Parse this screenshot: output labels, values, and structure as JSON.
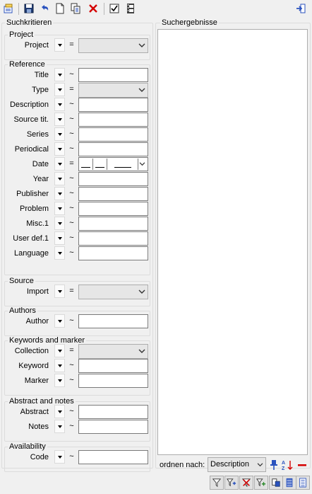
{
  "toolbar": {
    "buttons": [
      {
        "icon": "new-query-icon"
      },
      {
        "icon": "save-icon"
      },
      {
        "icon": "undo-icon"
      },
      {
        "icon": "new-document-icon"
      },
      {
        "icon": "copy-icon"
      },
      {
        "icon": "delete-icon"
      },
      {
        "icon": "checkbox-icon"
      },
      {
        "icon": "film-strip-icon"
      },
      {
        "icon": "exit-icon"
      }
    ]
  },
  "criteria_title": "Suchkritieren",
  "results_title": "Suchergebnisse",
  "groups": {
    "project": {
      "legend": "Project",
      "rows": [
        {
          "label": "Project",
          "op": "=",
          "kind": "combo",
          "value": ""
        }
      ]
    },
    "reference": {
      "legend": "Reference",
      "rows": [
        {
          "label": "Title",
          "op": "~",
          "kind": "text",
          "value": ""
        },
        {
          "label": "Type",
          "op": "=",
          "kind": "combo",
          "value": ""
        },
        {
          "label": "Description",
          "op": "~",
          "kind": "text",
          "value": ""
        },
        {
          "label": "Source tit.",
          "op": "~",
          "kind": "text",
          "value": ""
        },
        {
          "label": "Series",
          "op": "~",
          "kind": "text",
          "value": ""
        },
        {
          "label": "Periodical",
          "op": "~",
          "kind": "text",
          "value": ""
        },
        {
          "label": "Date",
          "op": "=",
          "kind": "date",
          "value": ""
        },
        {
          "label": "Year",
          "op": "~",
          "kind": "text",
          "value": ""
        },
        {
          "label": "Publisher",
          "op": "~",
          "kind": "text",
          "value": ""
        },
        {
          "label": "Problem",
          "op": "~",
          "kind": "text",
          "value": ""
        },
        {
          "label": "Misc.1",
          "op": "~",
          "kind": "text",
          "value": ""
        },
        {
          "label": "User def.1",
          "op": "~",
          "kind": "text",
          "value": ""
        },
        {
          "label": "Language",
          "op": "~",
          "kind": "text",
          "value": ""
        }
      ]
    },
    "source": {
      "legend": "Source",
      "rows": [
        {
          "label": "Import",
          "op": "=",
          "kind": "combo",
          "value": ""
        }
      ]
    },
    "authors": {
      "legend": "Authors",
      "rows": [
        {
          "label": "Author",
          "op": "~",
          "kind": "text",
          "value": ""
        }
      ]
    },
    "keywords": {
      "legend": "Keywords and marker",
      "rows": [
        {
          "label": "Collection",
          "op": "=",
          "kind": "combo",
          "value": ""
        },
        {
          "label": "Keyword",
          "op": "~",
          "kind": "text",
          "value": ""
        },
        {
          "label": "Marker",
          "op": "~",
          "kind": "text",
          "value": ""
        }
      ]
    },
    "abstract": {
      "legend": "Abstract and notes",
      "rows": [
        {
          "label": "Abstract",
          "op": "~",
          "kind": "text",
          "value": ""
        },
        {
          "label": "Notes",
          "op": "~",
          "kind": "text",
          "value": ""
        }
      ]
    },
    "availability": {
      "legend": "Availability",
      "rows": [
        {
          "label": "Code",
          "op": "~",
          "kind": "text",
          "value": ""
        }
      ]
    }
  },
  "sort": {
    "label": "ordnen nach:",
    "selected": "Description"
  },
  "bottom_buttons": [
    {
      "icon": "filter-icon"
    },
    {
      "icon": "add-filter-icon"
    },
    {
      "icon": "remove-filter-icon"
    },
    {
      "icon": "add-to-list-icon"
    },
    {
      "icon": "copy-to-list-icon"
    },
    {
      "icon": "list-icon"
    },
    {
      "icon": "list-detail-icon"
    }
  ],
  "colors": {
    "accent_blue": "#2a52be",
    "delete_red": "#d40000",
    "window_bg": "#f0f0f0"
  }
}
